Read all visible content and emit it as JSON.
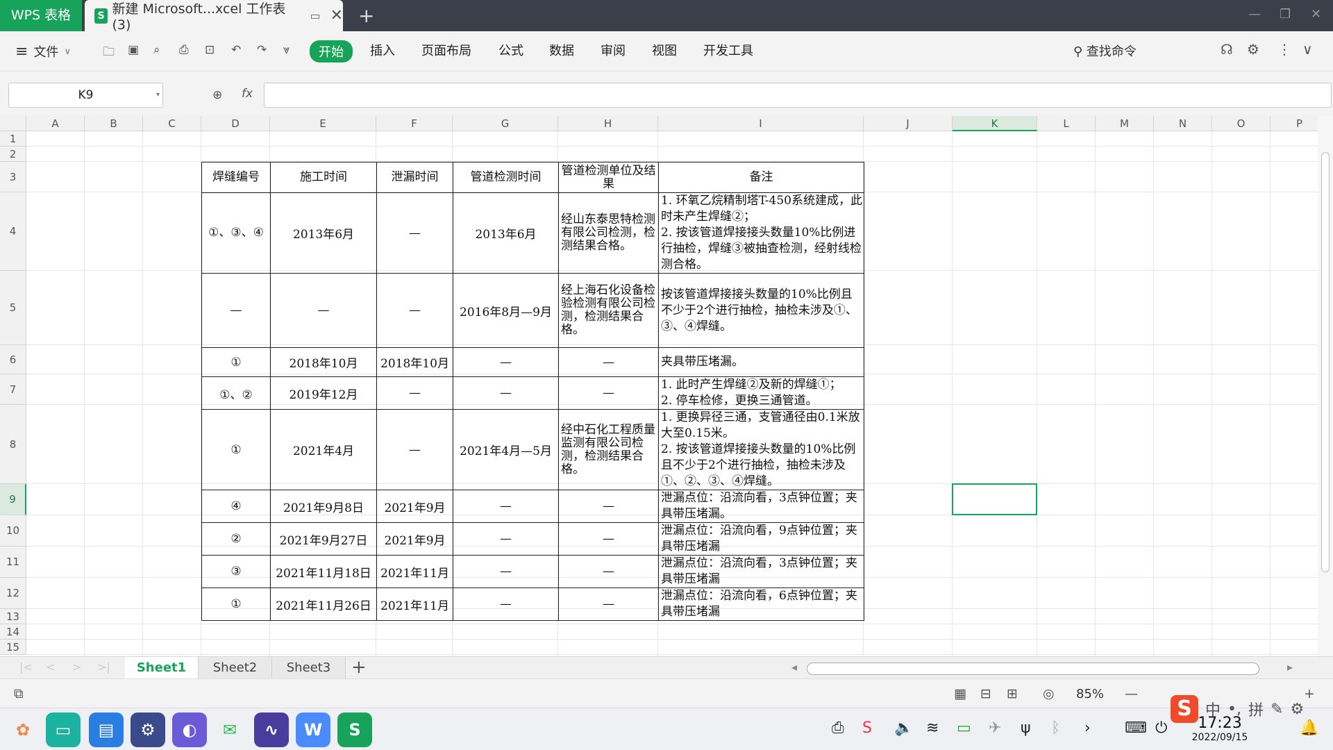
{
  "titlebar": {
    "app_label": "WPS 表格",
    "doc_tab_label": "新建 Microsoft...xcel 工作表 (3)",
    "new_tab": "+"
  },
  "menubar": {
    "file": "文件",
    "tabs": [
      "开始",
      "插入",
      "页面布局",
      "公式",
      "数据",
      "审阅",
      "视图",
      "开发工具"
    ],
    "search": "查找命令"
  },
  "formulabar": {
    "namebox": "K9",
    "fx": "fx",
    "formula": ""
  },
  "columns": [
    "A",
    "B",
    "C",
    "D",
    "E",
    "F",
    "G",
    "H",
    "I",
    "J",
    "K",
    "L",
    "M",
    "N",
    "O",
    "P"
  ],
  "selected_column": "K",
  "rows": [
    "1",
    "2",
    "3",
    "4",
    "5",
    "6",
    "7",
    "8",
    "9",
    "10",
    "11",
    "12",
    "13",
    "14",
    "15"
  ],
  "selected_row": "9",
  "table": {
    "headers": [
      "焊缝编号",
      "施工时间",
      "泄漏时间",
      "管道检测时间",
      "管道检测单位及结果",
      "备注"
    ],
    "rows": [
      [
        "①、③、④",
        "2013年6月",
        "—",
        "2013年6月",
        "经山东泰思特检测有限公司检测，检测结果合格。",
        "1. 环氧乙烷精制塔T-450系统建成，此时未产生焊缝②；\n2. 按该管道焊接接头数量10%比例进行抽检，焊缝③被抽查检测，经射线检测合格。"
      ],
      [
        "—",
        "—",
        "—",
        "2016年8月—9月",
        "经上海石化设备检验检测有限公司检测，检测结果合格。",
        "按该管道焊接接头数量的10%比例且不少于2个进行抽检，抽检未涉及①、③、④焊缝。"
      ],
      [
        "①",
        "2018年10月",
        "2018年10月",
        "—",
        "—",
        "夹具带压堵漏。"
      ],
      [
        "①、②",
        "2019年12月",
        "—",
        "—",
        "—",
        "1. 此时产生焊缝②及新的焊缝①；\n2. 停车检修，更换三通管道。"
      ],
      [
        "①",
        "2021年4月",
        "—",
        "2021年4月—5月",
        "经中石化工程质量监测有限公司检测，检测结果合格。",
        "1. 更换异径三通，支管通径由0.1米放大至0.15米。\n2. 按该管道焊接接头数量的10%比例且不少于2个进行抽检，抽检未涉及①、②、③、④焊缝。"
      ],
      [
        "④",
        "2021年9月8日",
        "2021年9月",
        "—",
        "—",
        "泄漏点位：沿流向看，3点钟位置；夹具带压堵漏。"
      ],
      [
        "②",
        "2021年9月27日",
        "2021年9月",
        "—",
        "—",
        "泄漏点位：沿流向看，9点钟位置；夹具带压堵漏"
      ],
      [
        "③",
        "2021年11月18日",
        "2021年11月",
        "—",
        "—",
        "泄漏点位：沿流向看，3点钟位置；夹具带压堵漏"
      ],
      [
        "①",
        "2021年11月26日",
        "2021年11月",
        "—",
        "—",
        "泄漏点位：沿流向看，6点钟位置；夹具带压堵漏"
      ]
    ]
  },
  "sheets": [
    "Sheet1",
    "Sheet2",
    "Sheet3"
  ],
  "active_sheet": "Sheet1",
  "status": {
    "zoom": "85%"
  },
  "taskbar": {
    "time": "17:23",
    "date": "2022/09/15"
  },
  "ime": {
    "mode": "中",
    "pinyin": "拼"
  },
  "colors": {
    "accent": "#17a35a",
    "titlebar": "#3b3f4a"
  }
}
